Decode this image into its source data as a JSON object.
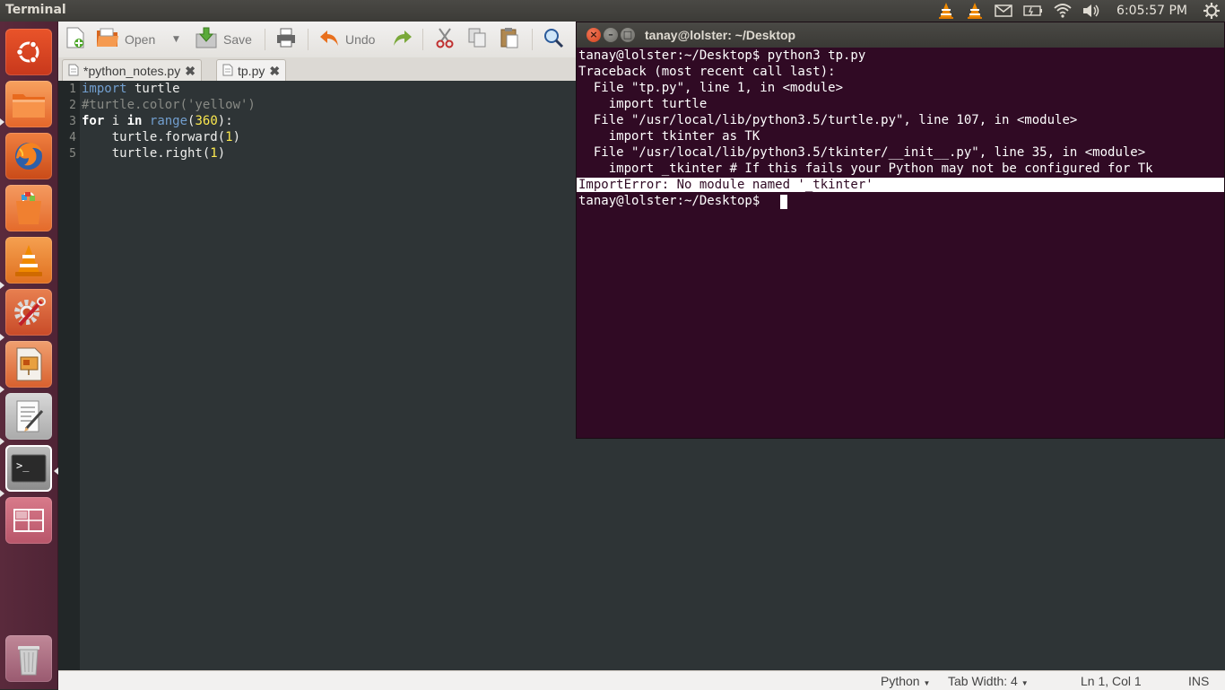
{
  "top_panel": {
    "app_title": "Terminal",
    "clock": "6:05:57 PM",
    "indicator_icons": [
      "vlc-tray-icon",
      "vlc-tray-icon",
      "mail-icon",
      "battery-icon",
      "wifi-icon",
      "volume-icon",
      "system-gear-icon"
    ]
  },
  "launcher": {
    "items": [
      {
        "name": "ubuntu-dash-icon"
      },
      {
        "name": "files-icon"
      },
      {
        "name": "firefox-icon"
      },
      {
        "name": "software-center-icon"
      },
      {
        "name": "vlc-icon"
      },
      {
        "name": "system-settings-icon"
      },
      {
        "name": "impress-icon"
      },
      {
        "name": "text-editor-icon"
      },
      {
        "name": "terminal-icon"
      },
      {
        "name": "workspace-switcher-icon"
      },
      {
        "name": "trash-icon"
      }
    ]
  },
  "gedit": {
    "toolbar": {
      "open_label": "Open",
      "save_label": "Save",
      "undo_label": "Undo"
    },
    "tabs": [
      {
        "label": "*python_notes.py"
      },
      {
        "label": "tp.py"
      }
    ],
    "code_lines": [
      {
        "num": "1",
        "text": "import turtle"
      },
      {
        "num": "2",
        "text": "#turtle.color('yellow')"
      },
      {
        "num": "3",
        "text": "for i in range(360):"
      },
      {
        "num": "4",
        "text": "    turtle.forward(1)"
      },
      {
        "num": "5",
        "text": "    turtle.right(1)"
      }
    ],
    "status": {
      "language": "Python",
      "tab_width": "Tab Width: 4",
      "position": "Ln 1, Col 1",
      "mode": "INS"
    }
  },
  "terminal": {
    "title": "tanay@lolster: ~/Desktop",
    "lines": [
      "tanay@lolster:~/Desktop$ python3 tp.py",
      "Traceback (most recent call last):",
      "  File \"tp.py\", line 1, in <module>",
      "    import turtle",
      "  File \"/usr/local/lib/python3.5/turtle.py\", line 107, in <module>",
      "    import tkinter as TK",
      "  File \"/usr/local/lib/python3.5/tkinter/__init__.py\", line 35, in <module>",
      "    import _tkinter # If this fails your Python may not be configured for Tk",
      "ImportError: No module named '_tkinter'",
      "tanay@lolster:~/Desktop$ "
    ]
  },
  "colors": {
    "launcher_bg": "#5a2a3c",
    "terminal_bg": "#300a24",
    "editor_bg": "#2e3436",
    "panel_bg": "#3c3b37"
  }
}
